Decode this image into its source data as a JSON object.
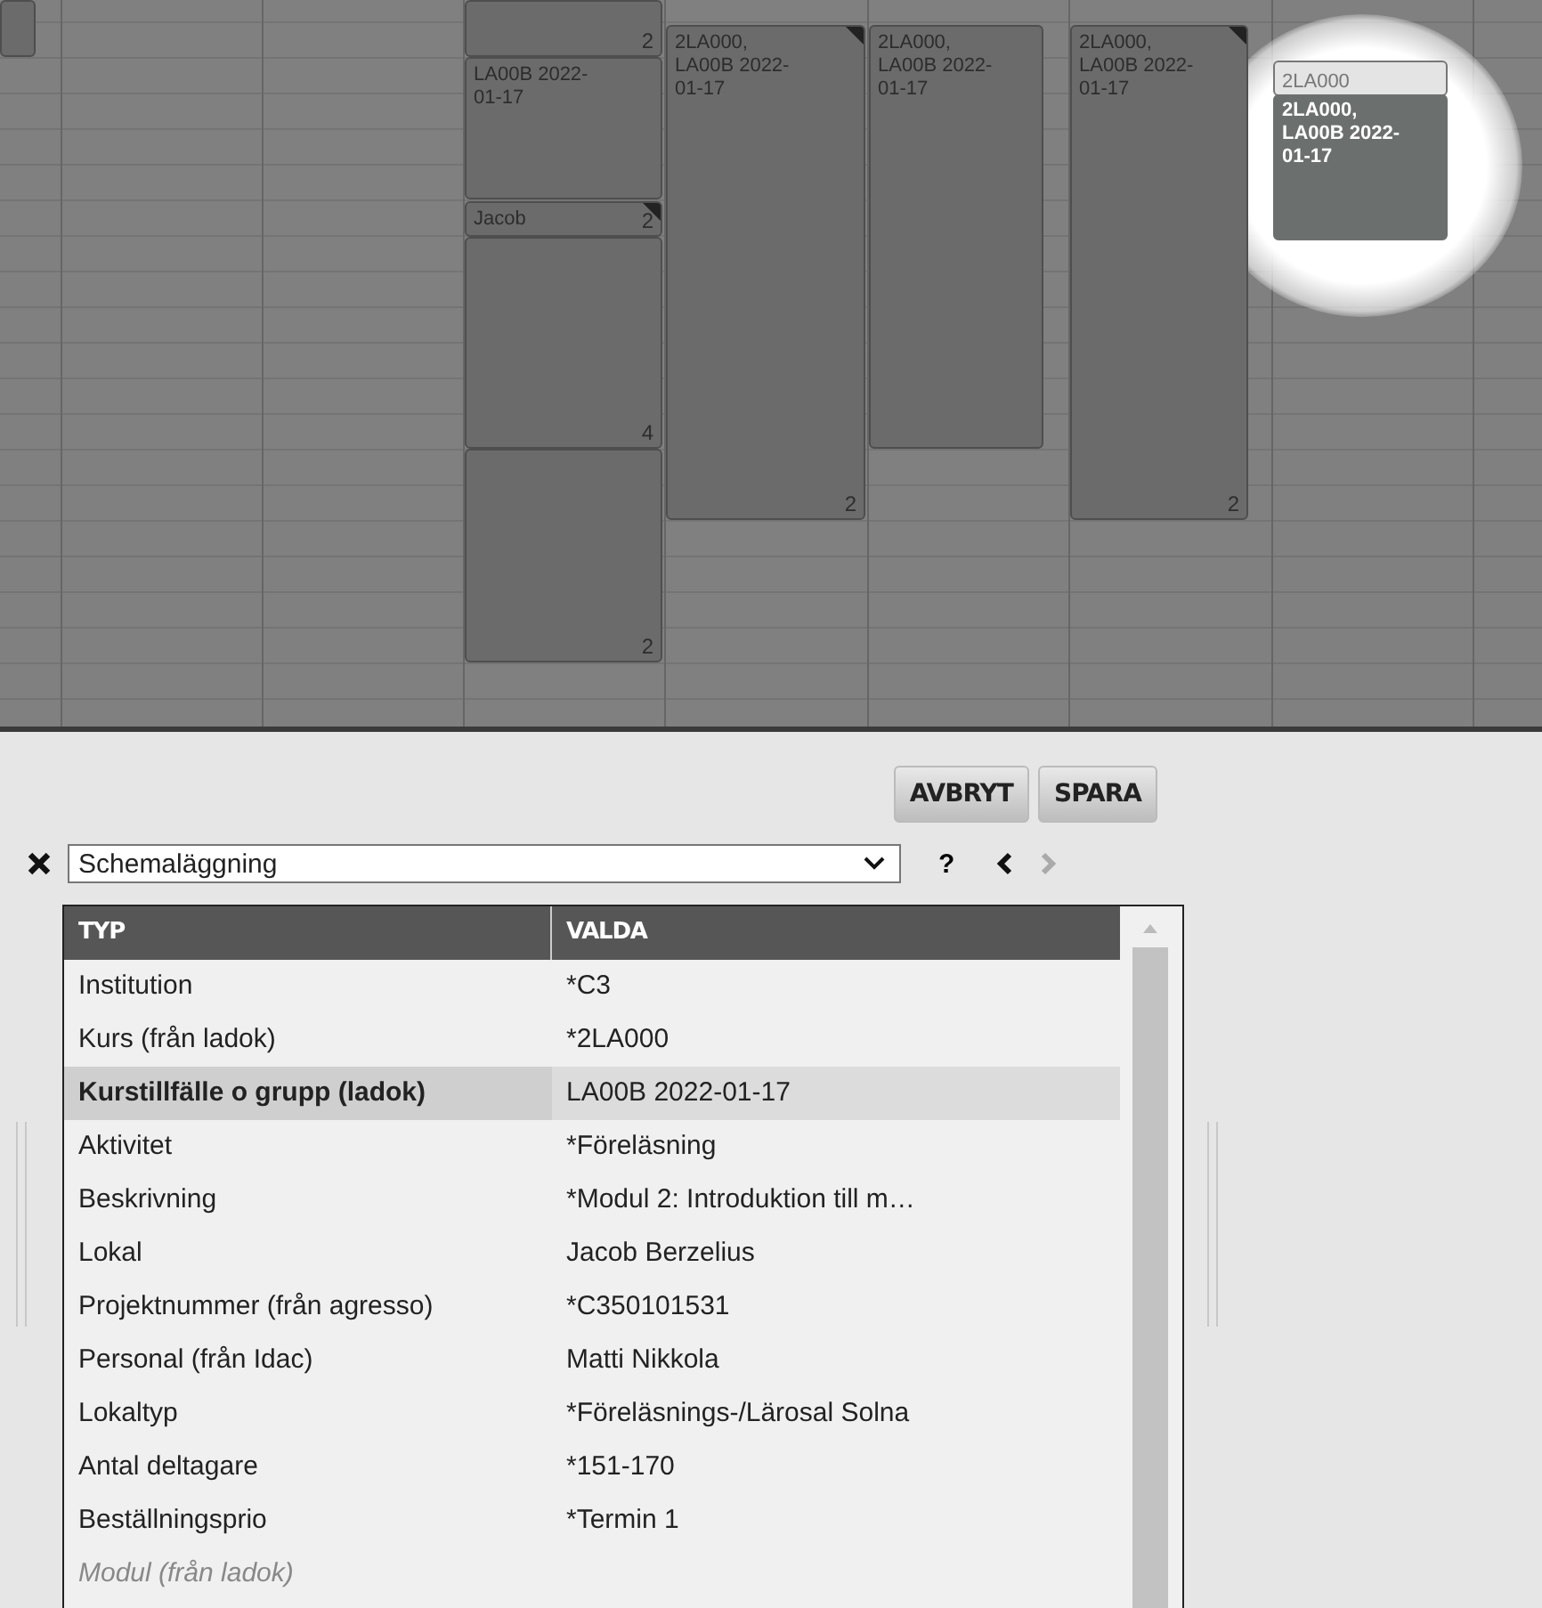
{
  "calendar": {
    "events": [
      {
        "flag": false,
        "selected": false
      },
      {
        "count": "2",
        "flag": false,
        "selected": false
      },
      {
        "text": "LA00B 2022-\n01-17",
        "flag": false,
        "selected": false
      },
      {
        "text": "Jacob",
        "count": "2",
        "flag": true,
        "selected": false
      },
      {
        "count": "4",
        "flag": false,
        "selected": false
      },
      {
        "count": "2",
        "flag": false,
        "selected": false
      },
      {
        "text": "2LA000,\nLA00B 2022-\n01-17",
        "count": "2",
        "flag": true,
        "selected": false
      },
      {
        "text": "2LA000,\nLA00B 2022-\n01-17",
        "flag": false,
        "selected": false
      },
      {
        "text": "2LA000,\nLA00B 2022-\n01-17",
        "count": "2",
        "flag": true,
        "selected": false
      },
      {
        "text": "2LA000",
        "flag": false,
        "selected": false,
        "kind": "ghost"
      },
      {
        "text": "2LA000,\nLA00B 2022-\n01-17",
        "flag": false,
        "selected": true
      }
    ]
  },
  "buttons": [
    "AVBRYT",
    "SPARA"
  ],
  "view_select": {
    "value": "Schemaläggning"
  },
  "help": "?",
  "table": {
    "columns": [
      "TYP",
      "VALDA"
    ],
    "rows": [
      {
        "label": "Institution",
        "value": "*C3",
        "selected": false,
        "kind": "normal"
      },
      {
        "label": "Kurs (från ladok)",
        "value": "*2LA000",
        "selected": false,
        "kind": "normal"
      },
      {
        "label": "Kurstillfälle o grupp (ladok)",
        "value": "LA00B 2022-01-17",
        "selected": true,
        "kind": "normal"
      },
      {
        "label": "Aktivitet",
        "value": "*Föreläsning",
        "selected": false,
        "kind": "normal"
      },
      {
        "label": "Beskrivning",
        "value": "*Modul 2: Introduktion till m…",
        "selected": false,
        "kind": "normal"
      },
      {
        "label": "Lokal",
        "value": "Jacob Berzelius",
        "selected": false,
        "kind": "normal"
      },
      {
        "label": "Projektnummer (från agresso)",
        "value": "*C350101531",
        "selected": false,
        "kind": "normal"
      },
      {
        "label": "Personal (från Idac)",
        "value": "Matti Nikkola",
        "selected": false,
        "kind": "normal"
      },
      {
        "label": "Lokaltyp",
        "value": "*Föreläsnings-/Lärosal Solna",
        "selected": false,
        "kind": "normal"
      },
      {
        "label": "Antal deltagare",
        "value": "*151-170",
        "selected": false,
        "kind": "normal"
      },
      {
        "label": "Beställningsprio",
        "value": "*Termin 1",
        "selected": false,
        "kind": "normal"
      },
      {
        "label": "Modul (från ladok)",
        "selected": false,
        "kind": "empty"
      }
    ]
  }
}
